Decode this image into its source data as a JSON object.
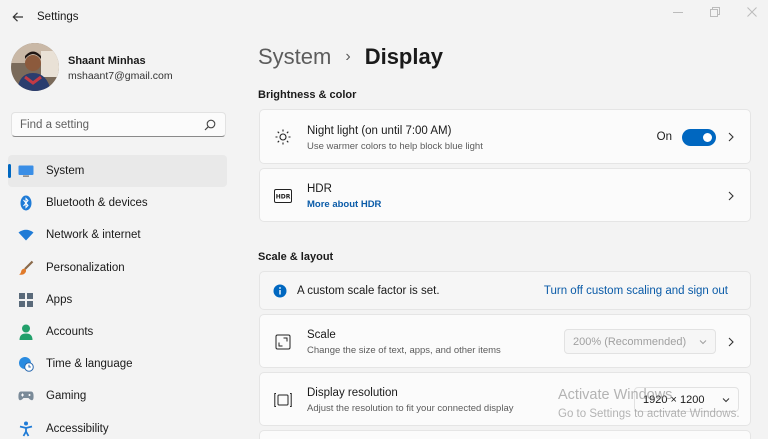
{
  "window": {
    "title": "Settings"
  },
  "user": {
    "name": "Shaant Minhas",
    "email": "mshaant7@gmail.com"
  },
  "search": {
    "placeholder": "Find a setting"
  },
  "nav": [
    {
      "label": "System",
      "icon": "system-icon",
      "active": true
    },
    {
      "label": "Bluetooth & devices",
      "icon": "bluetooth-icon"
    },
    {
      "label": "Network & internet",
      "icon": "wifi-icon"
    },
    {
      "label": "Personalization",
      "icon": "brush-icon"
    },
    {
      "label": "Apps",
      "icon": "apps-icon"
    },
    {
      "label": "Accounts",
      "icon": "person-icon"
    },
    {
      "label": "Time & language",
      "icon": "globe-clock-icon"
    },
    {
      "label": "Gaming",
      "icon": "gamepad-icon"
    },
    {
      "label": "Accessibility",
      "icon": "accessibility-icon"
    }
  ],
  "breadcrumb": {
    "parent": "System",
    "separator": "›",
    "current": "Display"
  },
  "sections": {
    "brightness": "Brightness & color",
    "scale": "Scale & layout"
  },
  "night_light": {
    "title": "Night light (on until 7:00 AM)",
    "subtitle": "Use warmer colors to help block blue light",
    "state_label": "On",
    "enabled": true
  },
  "hdr": {
    "title": "HDR",
    "link": "More about HDR",
    "icon_text": "HDR"
  },
  "info_bar": {
    "text": "A custom scale factor is set.",
    "link": "Turn off custom scaling and sign out"
  },
  "scale": {
    "title": "Scale",
    "subtitle": "Change the size of text, apps, and other items",
    "value": "200% (Recommended)"
  },
  "resolution": {
    "title": "Display resolution",
    "subtitle": "Adjust the resolution to fit your connected display",
    "value": "1920 × 1200"
  },
  "watermark": {
    "line1": "Activate Windows",
    "line2": "Go to Settings to activate Windows."
  },
  "colors": {
    "accent": "#0067c0",
    "link": "#0a5ba8",
    "background": "#f3f3f3"
  }
}
